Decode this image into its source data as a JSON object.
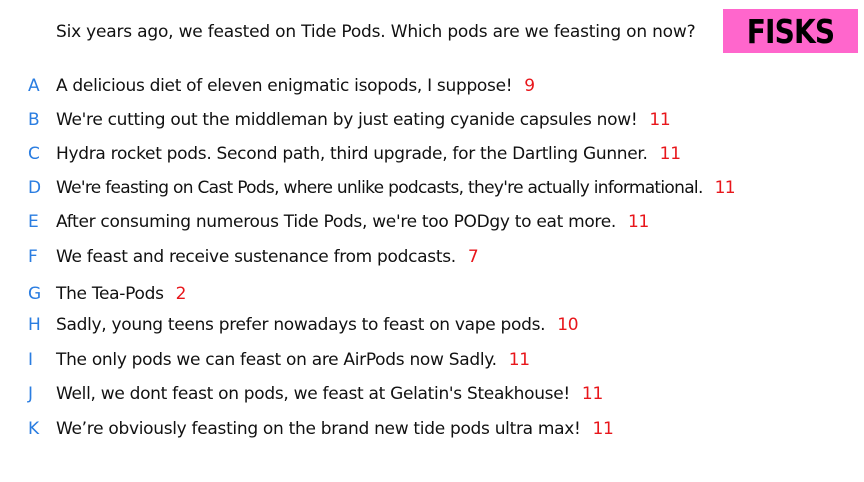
{
  "question": "Six years ago, we feasted on Tide Pods. Which pods are we feasting on now?",
  "logo": {
    "text": "FISKS",
    "color": "#ff66cc"
  },
  "colors": {
    "letter": "#2a7de1",
    "score": "#e8161b",
    "text": "#111111"
  },
  "answers": [
    {
      "letter": "A",
      "text": "A delicious diet of eleven enigmatic isopods, I suppose!",
      "score": "9"
    },
    {
      "letter": "B",
      "text": "We're cutting out the middleman by just eating cyanide capsules now!",
      "score": "11"
    },
    {
      "letter": "C",
      "text": "Hydra rocket pods. Second path, third upgrade, for the Dartling Gunner.",
      "score": "11"
    },
    {
      "letter": "D",
      "text": "We're feasting on Cast Pods, where unlike podcasts, they're actually informational.",
      "score": "11"
    },
    {
      "letter": "E",
      "text": "After consuming numerous Tide Pods, we're too PODgy to eat more.",
      "score": "11"
    },
    {
      "letter": "F",
      "text": "We feast and receive sustenance from podcasts.",
      "score": "7"
    },
    {
      "letter": "G",
      "text": "The Tea-Pods",
      "score": "2"
    },
    {
      "letter": "H",
      "text": "Sadly, young teens prefer nowadays to feast on vape pods.",
      "score": "10"
    },
    {
      "letter": "I",
      "text": "The only pods we can feast on are AirPods now Sadly.",
      "score": "11"
    },
    {
      "letter": "J",
      "text": "Well, we dont feast on pods, we feast at Gelatin's Steakhouse!",
      "score": "11"
    },
    {
      "letter": "K",
      "text": "We’re obviously feasting on the brand new tide pods ultra max!",
      "score": "11"
    }
  ]
}
